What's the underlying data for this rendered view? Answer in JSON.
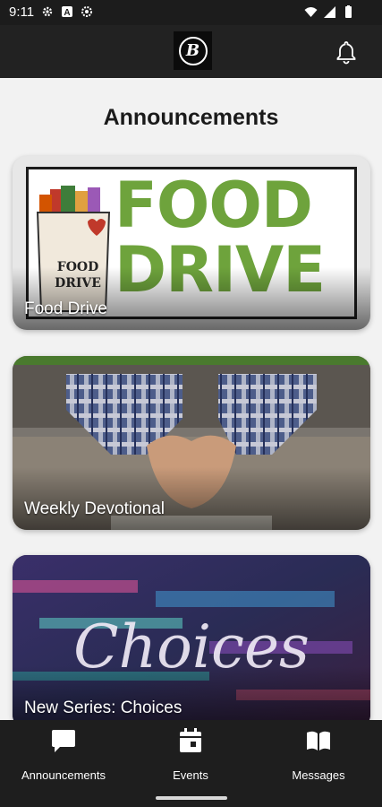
{
  "status_bar": {
    "time": "9:11",
    "left_icons": [
      "settings-icon",
      "a-icon",
      "gear-icon"
    ],
    "right_icons": [
      "wifi-icon",
      "signal-icon",
      "battery-icon"
    ]
  },
  "header": {
    "logo_letter": "B",
    "icons": [
      "logo-icon",
      "bell-icon"
    ]
  },
  "main": {
    "title": "Announcements",
    "cards": [
      {
        "label": "Food Drive",
        "art_text_top": "FOOD",
        "art_text_bottom": "DRIVE",
        "bag_text": "FOOD DRIVE"
      },
      {
        "label": "Weekly Devotional"
      },
      {
        "label": "New Series: Choices",
        "art_text": "Choices"
      }
    ]
  },
  "bottom_nav": {
    "items": [
      {
        "label": "Announcements",
        "icon": "chat-bubble-icon"
      },
      {
        "label": "Events",
        "icon": "calendar-icon"
      },
      {
        "label": "Messages",
        "icon": "book-icon"
      }
    ]
  },
  "colors": {
    "food_green": "#6ea33c",
    "header_bg": "#222222",
    "content_bg": "#f2f2f2"
  }
}
